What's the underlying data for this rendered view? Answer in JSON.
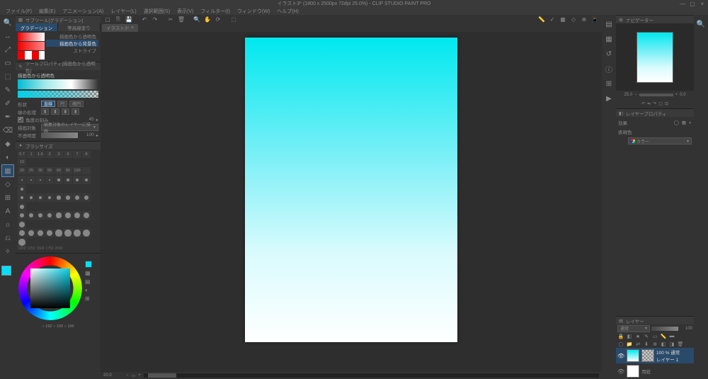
{
  "title": "イラスト3* (1800 x 2500px 72dpi 25.0%) - CLIP STUDIO PAINT PRO",
  "menu": [
    "ファイル(F)",
    "編集(E)",
    "アニメーション(A)",
    "レイヤー(L)",
    "選択範囲(S)",
    "表示(V)",
    "フィルター(I)",
    "ウィンドウ(W)",
    "ヘルプ(H)"
  ],
  "toolstrip": [
    {
      "icon": "🔍",
      "name": "zoom"
    },
    {
      "icon": "↔",
      "name": "move"
    },
    {
      "icon": "⤢",
      "name": "rotate"
    },
    {
      "icon": "▭",
      "name": "marquee"
    },
    {
      "icon": "⬚",
      "name": "select-auto"
    },
    {
      "icon": "✎",
      "name": "pen"
    },
    {
      "icon": "✐",
      "name": "pencil"
    },
    {
      "icon": "✒",
      "name": "brush"
    },
    {
      "icon": "⌫",
      "name": "eraser"
    },
    {
      "icon": "◆",
      "name": "blend"
    },
    {
      "icon": "◐",
      "name": "fill"
    },
    {
      "icon": "▦",
      "name": "gradient",
      "sel": true
    },
    {
      "icon": "◇",
      "name": "figure"
    },
    {
      "icon": "⊞",
      "name": "frame"
    },
    {
      "icon": "A",
      "name": "text"
    },
    {
      "icon": "☼",
      "name": "balloon"
    },
    {
      "icon": "⎌",
      "name": "correct"
    },
    {
      "icon": "✧",
      "name": "deco"
    }
  ],
  "subtool": {
    "header": "サブツール[グラデーション]",
    "tabs": [
      {
        "label": "グラデーション",
        "sel": true
      },
      {
        "label": "等高線塗り",
        "sel": false
      }
    ],
    "items": [
      {
        "label": "描画色から透明色",
        "sel": false
      },
      {
        "label": "描画色から背景色",
        "sel": true
      },
      {
        "label": "ストライプ",
        "sel": false
      }
    ]
  },
  "toolprop": {
    "header": "ツールプロパティ[描画色から透明色]",
    "grad_name": "描画色から透明色",
    "shape_label": "形状",
    "shape_options": [
      {
        "label": "直線",
        "sel": true
      },
      {
        "label": "円",
        "sel": false
      },
      {
        "label": "楕円",
        "sel": false
      }
    ],
    "edge_label": "端の処理",
    "angle_check": true,
    "angle_label": "角度の刻み",
    "angle_value": "45",
    "target_label": "描画対象",
    "target_value": "編集対象のレイヤーに描画",
    "opacity_label": "不透明度",
    "opacity_value": "100"
  },
  "brush": {
    "header": "ブラシサイズ",
    "nums": [
      "0.7",
      "1",
      "1.5",
      "2",
      "3",
      "5",
      "7",
      "8",
      "10"
    ],
    "nums2": [
      "20",
      "25",
      "35",
      "50",
      "60",
      "80",
      "100",
      ""
    ],
    "labels": [
      "1000",
      "1250",
      "1500",
      "1750",
      "2000"
    ]
  },
  "color_readout": "○ 192 ○ 100 ○ 100",
  "doc_tab": {
    "label": "イラスト3*",
    "close": "×"
  },
  "zoom": "20.0",
  "navigator": {
    "header": "ナビゲーター",
    "zoom_l": "25.0",
    "zoom_r": "0.0"
  },
  "layerprop": {
    "header": "レイヤープロパティ",
    "effect_label": "効果",
    "expr_label": "表現色",
    "expr_value": "カラー"
  },
  "layers": {
    "header": "レイヤー",
    "blend": "通常",
    "opacity": "100",
    "items": [
      {
        "name": "レイヤー 1",
        "meta": "100 % 通常",
        "thumb": "grad",
        "sel": true
      },
      {
        "name": "用紙",
        "meta": "",
        "thumb": "paper",
        "sel": false
      }
    ]
  }
}
